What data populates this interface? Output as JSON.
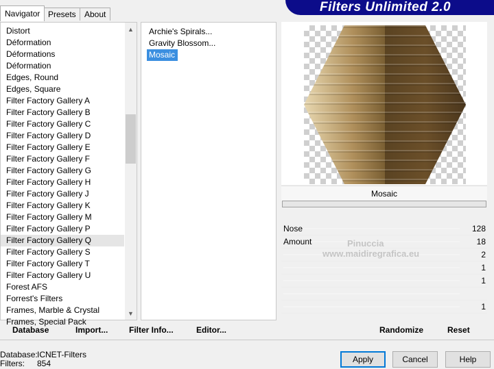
{
  "tabs": [
    "Navigator",
    "Presets",
    "About"
  ],
  "banner_title": "Filters Unlimited 2.0",
  "categories": [
    "Distort",
    "Déformation",
    "Déformations",
    "Déformation",
    "Edges, Round",
    "Edges, Square",
    "Filter Factory Gallery A",
    "Filter Factory Gallery B",
    "Filter Factory Gallery C",
    "Filter Factory Gallery D",
    "Filter Factory Gallery E",
    "Filter Factory Gallery F",
    "Filter Factory Gallery G",
    "Filter Factory Gallery H",
    "Filter Factory Gallery J",
    "Filter Factory Gallery K",
    "Filter Factory Gallery M",
    "Filter Factory Gallery P",
    "Filter Factory Gallery Q",
    "Filter Factory Gallery S",
    "Filter Factory Gallery T",
    "Filter Factory Gallery U",
    "Forest AFS",
    "Forrest's Filters",
    "Frames, Marble & Crystal",
    "Frames, Special Pack"
  ],
  "selected_category_index": 18,
  "filters": [
    "Archie's Spirals...",
    "Gravity Blossom...",
    "Mosaic"
  ],
  "selected_filter_index": 2,
  "nav_buttons": {
    "database": "Database",
    "import": "Import...",
    "filter_info": "Filter Info...",
    "editor": "Editor..."
  },
  "preview": {
    "filter_name": "Mosaic"
  },
  "controls": [
    {
      "label": "Nose",
      "value": "128"
    },
    {
      "label": "Amount",
      "value": "18"
    },
    {
      "label": "",
      "value": "2"
    },
    {
      "label": "",
      "value": "1"
    },
    {
      "label": "",
      "value": "1"
    },
    {
      "label": "",
      "value": ""
    },
    {
      "label": "",
      "value": "1"
    }
  ],
  "actions": {
    "randomize": "Randomize",
    "reset": "Reset"
  },
  "info": {
    "database_label": "Database:",
    "database_value": "ICNET-Filters",
    "filters_label": "Filters:",
    "filters_value": "854"
  },
  "dialog_buttons": {
    "apply": "Apply",
    "cancel": "Cancel",
    "help": "Help"
  },
  "watermark": {
    "line1": "Pinuccia",
    "line2": "www.maidiregrafica.eu"
  }
}
